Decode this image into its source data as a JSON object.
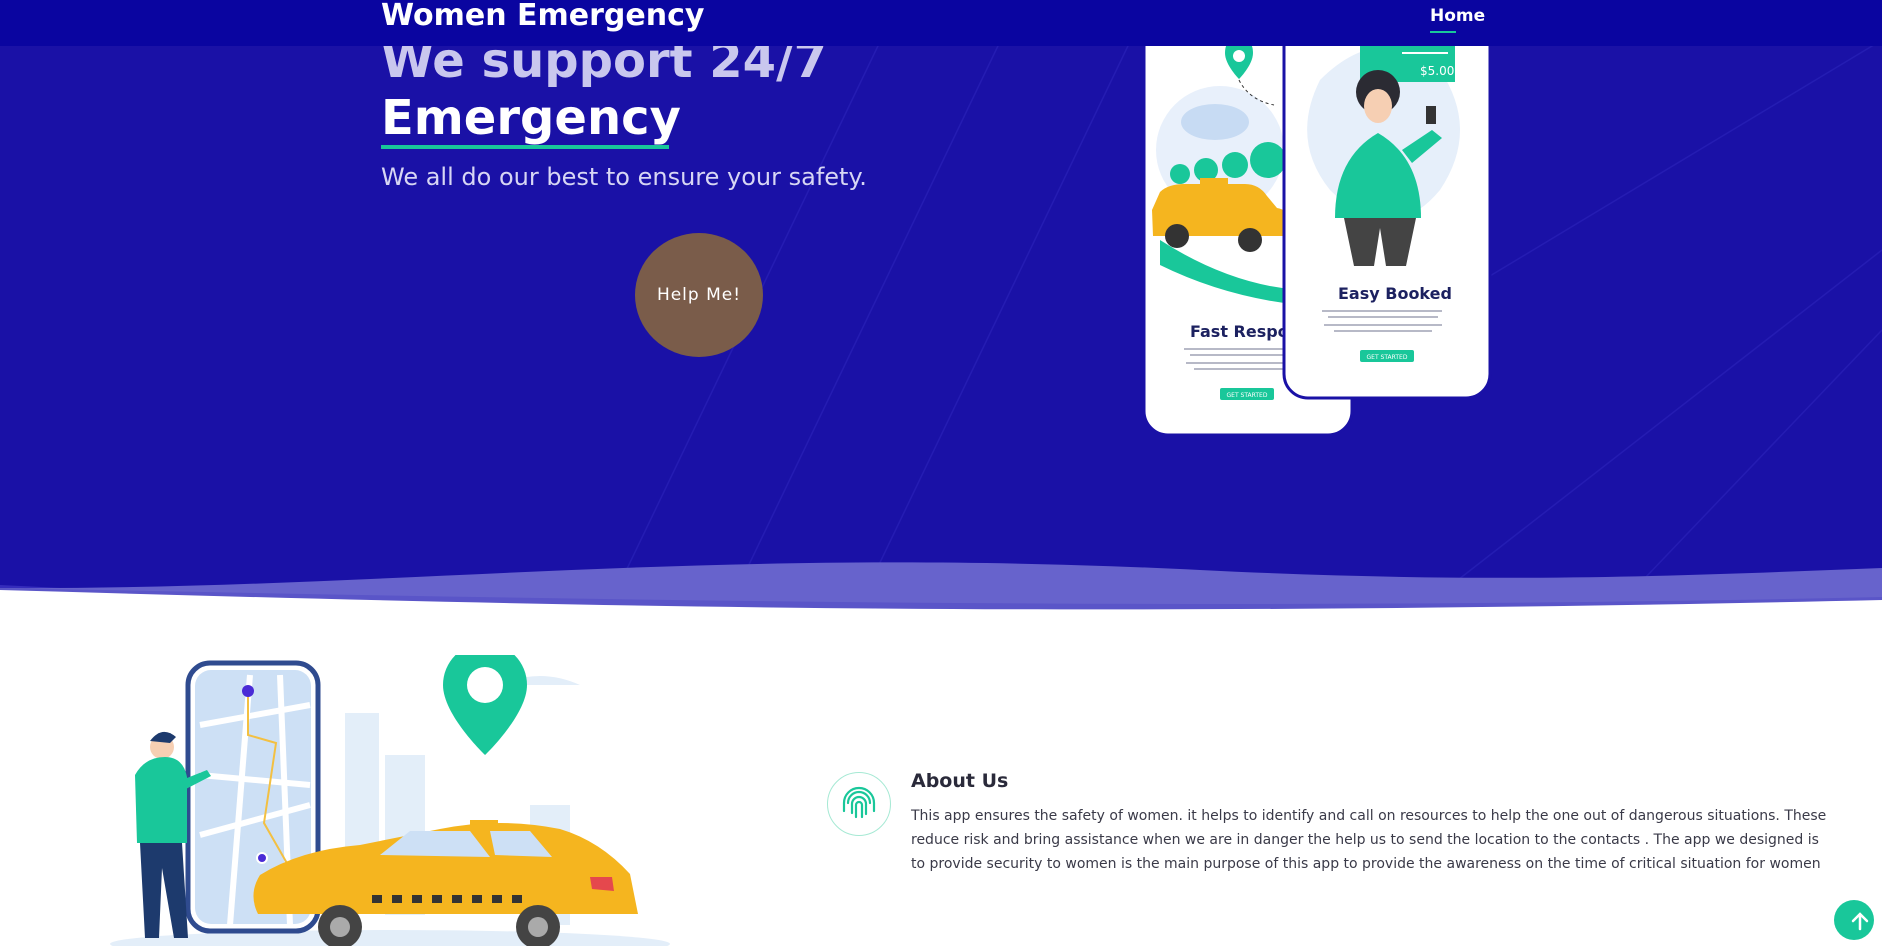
{
  "brand": "Women Emergency",
  "nav": {
    "home": "Home"
  },
  "hero": {
    "headline_line1": "We support 24/7",
    "headline_line2": "Emergency",
    "tagline": "We all do our best to ensure your safety.",
    "cta": "Help Me!"
  },
  "phones": {
    "left_title": "Fast Respor",
    "left_button": "GET STARTED",
    "right_title": "Easy Booked",
    "right_button": "GET STARTED",
    "price": "$5.00"
  },
  "about": {
    "title": "About Us",
    "text": "This app ensures the safety of women. it helps to identify and call on resources to help the one out of dangerous situations. These reduce risk and bring assistance when we are in danger the help us to send the location to the contacts . The app we designed is to provide security to women is the main purpose of this app to provide the awareness on the time of critical situation for women"
  },
  "colors": {
    "hero_bg": "#1a11a6",
    "navbar": "#0a05a0",
    "accent": "#19c79a",
    "cta": "#7a5c4a"
  },
  "icons": {
    "about": "fingerprint-icon",
    "scroll_top": "arrow-up-icon"
  }
}
